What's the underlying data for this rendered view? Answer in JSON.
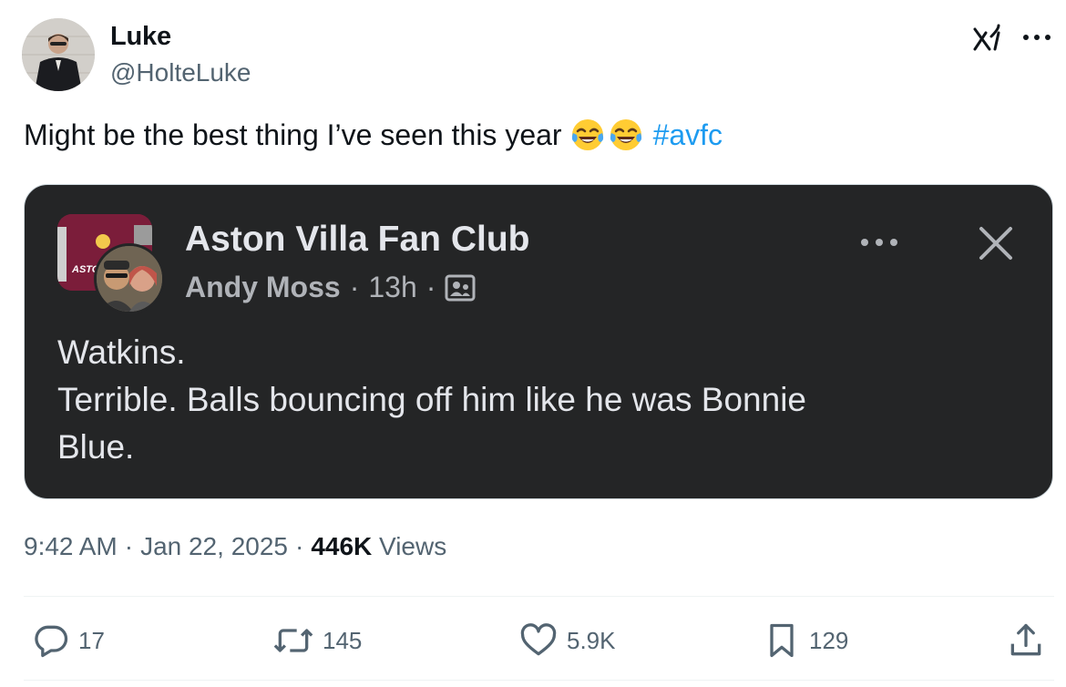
{
  "author": {
    "name": "Luke",
    "handle": "@HolteLuke",
    "avatar_icon": "profile-photo-avatar"
  },
  "tweet": {
    "text": "Might be the best thing I’ve seen this year",
    "emojis": [
      "face-with-tears-of-joy",
      "face-with-tears-of-joy"
    ],
    "hashtag": "#avfc"
  },
  "embedded_post": {
    "group_name": "Aston Villa Fan Club",
    "thumb_text": "ASTON VILLA FAN",
    "author": "Andy Moss",
    "separator": "·",
    "time": "13h",
    "audience_icon": "group-members-icon",
    "body_lines": [
      "Watkins.",
      "Terrible. Balls bouncing off him like he was Bonnie",
      "Blue."
    ]
  },
  "meta": {
    "time": "9:42 AM",
    "separator": "·",
    "date": "Jan 22, 2025",
    "views_count": "446K",
    "views_label": "Views"
  },
  "actions": {
    "replies": "17",
    "reposts": "145",
    "likes": "5.9K",
    "bookmarks": "129"
  },
  "colors": {
    "text_primary": "#0f1419",
    "text_secondary": "#536471",
    "link_blue": "#1d9bf0",
    "card_bg": "#242526",
    "card_text": "#e4e6eb",
    "card_meta": "#b0b3b8"
  }
}
